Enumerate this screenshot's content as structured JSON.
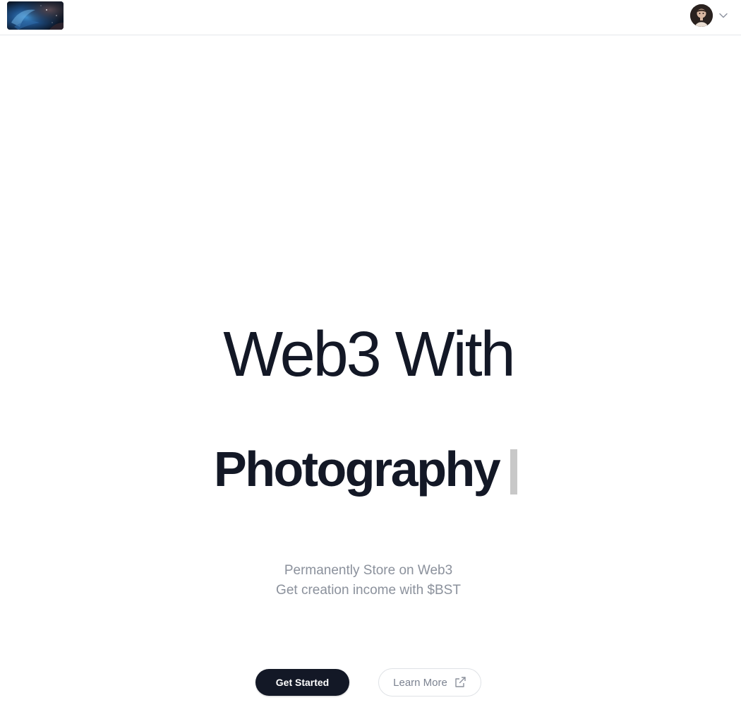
{
  "header": {
    "logo_icon": "galaxy-logo-image",
    "avatar_icon": "user-avatar-image",
    "menu_icon": "chevron-down-icon"
  },
  "hero": {
    "headline_line1": "Web3 With",
    "headline_line2": "Photography",
    "subtitle_line1": "Permanently Store on Web3",
    "subtitle_line2": "Get creation income with $BST",
    "primary_button_label": "Get Started",
    "secondary_button_label": "Learn More",
    "secondary_button_icon": "external-link-icon"
  },
  "colors": {
    "text_dark": "#131826",
    "text_muted": "#8b919c",
    "cursor_gray": "#c8c8c8",
    "border": "#e5e7eb"
  }
}
